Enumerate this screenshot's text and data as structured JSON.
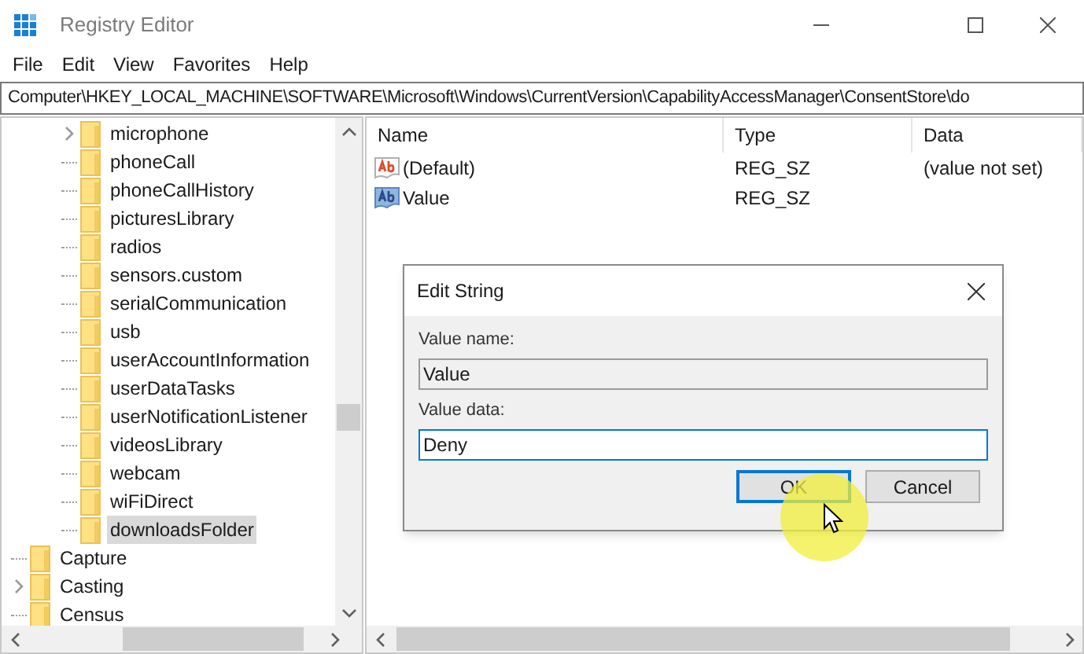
{
  "window": {
    "title": "Registry Editor"
  },
  "menu": [
    "File",
    "Edit",
    "View",
    "Favorites",
    "Help"
  ],
  "address": "Computer\\HKEY_LOCAL_MACHINE\\SOFTWARE\\Microsoft\\Windows\\CurrentVersion\\CapabilityAccessManager\\ConsentStore\\do",
  "tree": {
    "items": [
      {
        "children": [
          {
            "label": "microphone",
            "expandable": true,
            "selected": false
          },
          {
            "label": "phoneCall",
            "expandable": false,
            "selected": false
          },
          {
            "label": "phoneCallHistory",
            "expandable": false,
            "selected": false
          },
          {
            "label": "picturesLibrary",
            "expandable": false,
            "selected": false
          },
          {
            "label": "radios",
            "expandable": false,
            "selected": false
          },
          {
            "label": "sensors.custom",
            "expandable": false,
            "selected": false
          },
          {
            "label": "serialCommunication",
            "expandable": false,
            "selected": false
          },
          {
            "label": "usb",
            "expandable": false,
            "selected": false
          },
          {
            "label": "userAccountInformation",
            "expandable": false,
            "selected": false
          },
          {
            "label": "userDataTasks",
            "expandable": false,
            "selected": false
          },
          {
            "label": "userNotificationListener",
            "expandable": false,
            "selected": false
          },
          {
            "label": "videosLibrary",
            "expandable": false,
            "selected": false
          },
          {
            "label": "webcam",
            "expandable": false,
            "selected": false
          },
          {
            "label": "wiFiDirect",
            "expandable": false,
            "selected": false
          },
          {
            "label": "downloadsFolder",
            "expandable": false,
            "selected": true
          }
        ]
      },
      {
        "label": "Capture",
        "expandable": false,
        "selected": false
      },
      {
        "label": "Casting",
        "expandable": true,
        "selected": false
      },
      {
        "label": "Census",
        "expandable": false,
        "selected": false
      }
    ]
  },
  "table": {
    "columns": [
      "Name",
      "Type",
      "Data"
    ],
    "rows": [
      {
        "kind": "default",
        "name": "(Default)",
        "type": "REG_SZ",
        "data": "(value not set)"
      },
      {
        "kind": "value",
        "name": "Value",
        "type": "REG_SZ"
      }
    ]
  },
  "dialog": {
    "title": "Edit String",
    "fields": [
      {
        "label": "Value name:",
        "value": "Value",
        "readonly": true,
        "focused": false
      },
      {
        "label": "Value data:",
        "value": "Deny",
        "readonly": false,
        "focused": true
      }
    ],
    "buttons": [
      {
        "label": "OK",
        "default": true
      },
      {
        "label": "Cancel",
        "default": false
      }
    ]
  }
}
